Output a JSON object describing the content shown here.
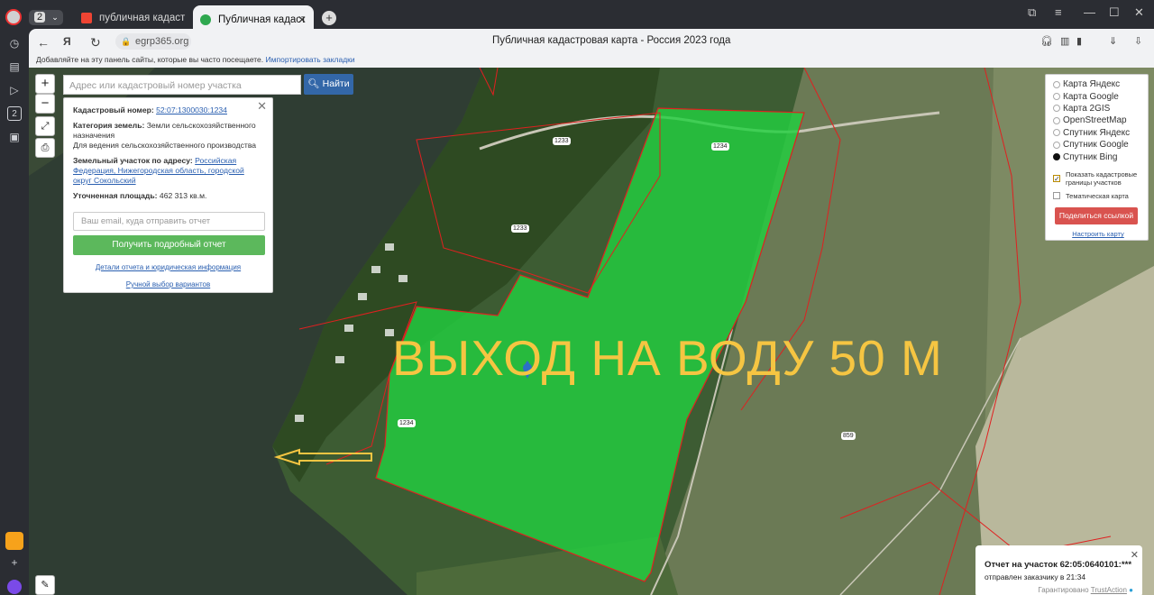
{
  "browser": {
    "profile_count": "2",
    "tabs": [
      {
        "label": "публичная кадастровая к",
        "active": false
      },
      {
        "label": "Публичная кадастровая",
        "active": true
      }
    ],
    "url": "egrp365.org",
    "page_title": "Публичная кадастровая карта - Россия 2023 года",
    "bookmarks_hint": "Добавляйте на эту панель сайты, которые вы часто посещаете.",
    "bookmarks_import": "Импортировать закладки",
    "sidebar_badge": "2"
  },
  "map": {
    "search_placeholder": "Адрес или кадастровый номер участка",
    "search_button": "Найти",
    "zoom_in": "+",
    "zoom_out": "−",
    "overlay_text": "ВЫХОД НА ВОДУ 50 М",
    "parcel_labels": [
      "1233",
      "1234",
      "1233",
      "1234",
      "859"
    ],
    "info": {
      "cad_label": "Кадастровый номер:",
      "cad_value": "52:07:1300030:1234",
      "category_label": "Категория земель:",
      "category_value": "Земли сельскохозяйственного назначения",
      "use_value": "Для ведения сельскохозяйственного производства",
      "address_label": "Земельный участок по адресу:",
      "address_value": "Российская Федерация, Нижегородская область, городской округ Сокольский",
      "area_label": "Уточненная площадь:",
      "area_value": "462 313 кв.м.",
      "email_placeholder": "Ваш email, куда отправить отчет",
      "report_button": "Получить подробный отчет",
      "details_link": "Детали отчета и юридическая информация",
      "manual_link": "Ручной выбор вариантов"
    },
    "layers": {
      "options": [
        "Карта Яндекс",
        "Карта Google",
        "Карта 2GIS",
        "OpenStreetMap",
        "Спутник Яндекс",
        "Спутник Google",
        "Спутник Bing"
      ],
      "selected": "Спутник Bing",
      "show_borders": "Показать кадастровые границы участков",
      "thematic": "Тематическая карта",
      "share_button": "Поделиться ссылкой",
      "configure_link": "Настроить карту"
    },
    "notification": {
      "title": "Отчет на участок 62:05:0640101:***",
      "subtitle": "отправлен заказчику в 21:34",
      "guarantee": "Гарантировано",
      "brand": "TrustAction"
    }
  },
  "colors": {
    "parcel_fill": "#22d040",
    "border_red": "#e02020",
    "overlay_text": "#f5c542",
    "accent_blue": "#3367a8"
  }
}
